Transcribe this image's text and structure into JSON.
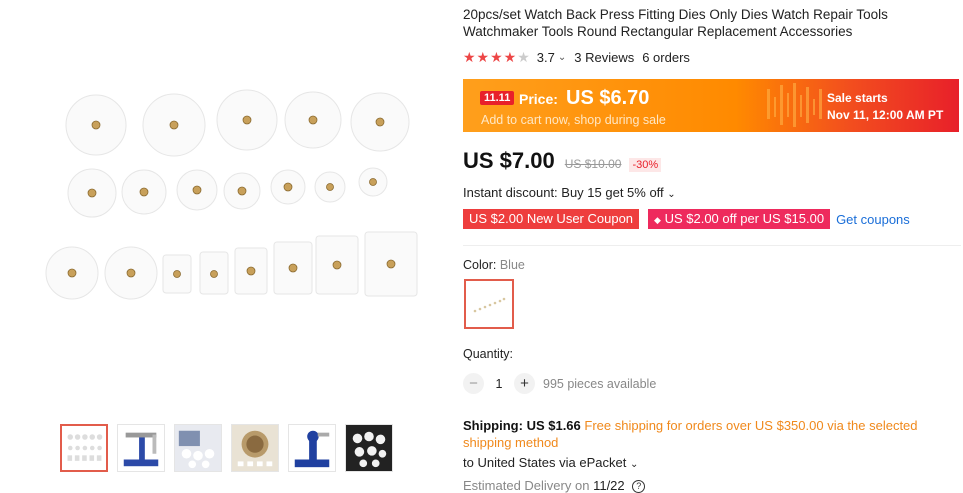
{
  "product": {
    "title": "20pcs/set Watch Back Press Fitting Dies Only Dies Watch Repair Tools Watchmaker Tools Round Rectangular Replacement Accessories",
    "rating": {
      "score": "3.7",
      "stars_filled": 4,
      "stars_total": 5,
      "reviews": "3 Reviews",
      "orders": "6 orders"
    }
  },
  "promo": {
    "badge": "11.11",
    "price_label": "Price:",
    "price": "US $6.70",
    "subtitle": "Add to cart now, shop during sale",
    "sale_line1": "Sale starts",
    "sale_line2": "Nov 11, 12:00 AM PT",
    "colors": {
      "start": "#ff9f1c",
      "end": "#e8202a"
    }
  },
  "pricing": {
    "current": "US $7.00",
    "original": "US $10.00",
    "discount": "-30%"
  },
  "instant_discount": "Instant discount: Buy 15 get 5% off",
  "coupons": {
    "new_user": "US $2.00 New User Coupon",
    "store": "US $2.00 off per US $15.00",
    "get_link": "Get coupons"
  },
  "color": {
    "label": "Color:",
    "value": "Blue"
  },
  "quantity": {
    "label": "Quantity:",
    "value": "1",
    "minus": "−",
    "plus": "+",
    "available": "995 pieces available"
  },
  "shipping": {
    "label": "Shipping:",
    "cost": "US $1.66",
    "free_note": "Free shipping for orders over US $350.00 via the selected shipping method",
    "destination": "to United States via ePacket",
    "eta_label": "Estimated Delivery on",
    "eta_date": "11/22",
    "help_icon": "?"
  },
  "gallery": {
    "thumbnails": [
      "dies-set",
      "press-tool",
      "dies-closeup",
      "watch-back",
      "press-tool-blue",
      "dies-dark"
    ]
  }
}
